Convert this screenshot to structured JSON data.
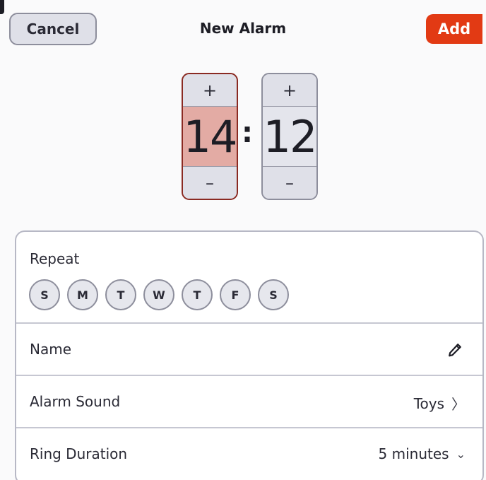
{
  "header": {
    "cancel_label": "Cancel",
    "title": "New Alarm",
    "add_label": "Add"
  },
  "time": {
    "hours": "14",
    "minutes": "12",
    "separator": ":",
    "increment_symbol": "+",
    "decrement_symbol": "–"
  },
  "repeat": {
    "label": "Repeat",
    "days": [
      "S",
      "M",
      "T",
      "W",
      "T",
      "F",
      "S"
    ]
  },
  "name": {
    "label": "Name",
    "icon": "pencil-icon"
  },
  "alarm_sound": {
    "label": "Alarm Sound",
    "value": "Toys",
    "icon": "chevron-right-icon"
  },
  "ring_duration": {
    "label": "Ring Duration",
    "value": "5 minutes",
    "icon": "chevron-down-icon"
  },
  "colors": {
    "accent": "#e23a14",
    "selected_spinner_bg": "#e3aba4",
    "selected_spinner_border": "#8a2a22"
  }
}
